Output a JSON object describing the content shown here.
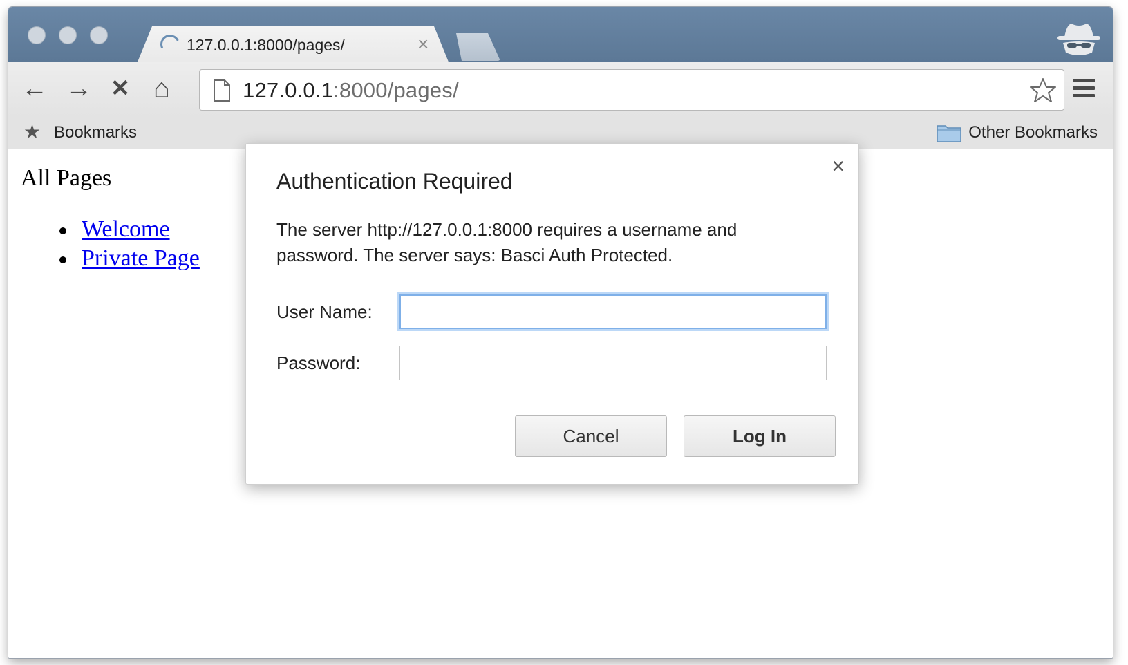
{
  "tab": {
    "title": "127.0.0.1:8000/pages/",
    "close_glyph": "×"
  },
  "toolbar": {
    "back_glyph": "←",
    "forward_glyph": "→",
    "stop_glyph": "✕",
    "home_glyph": "⌂",
    "url_host": "127.0.0.1",
    "url_rest": ":8000/pages/"
  },
  "bookmarks": {
    "label": "Bookmarks",
    "star_glyph": "★",
    "other_label": "Other Bookmarks"
  },
  "page": {
    "heading": "All Pages",
    "links": [
      "Welcome",
      "Private Page"
    ]
  },
  "dialog": {
    "title": "Authentication Required",
    "message": "The server http://127.0.0.1:8000 requires a username and password. The server says: Basci Auth Protected.",
    "username_label": "User Name:",
    "username_value": "",
    "password_label": "Password:",
    "password_value": "",
    "cancel_label": "Cancel",
    "login_label": "Log In",
    "close_glyph": "×"
  },
  "icons": {
    "traffic_lights": [
      "close-dot-icon",
      "minimize-dot-icon",
      "maximize-dot-icon"
    ],
    "incognito": "incognito-icon",
    "page": "page-document-icon",
    "star": "bookmark-star-icon",
    "menu": "hamburger-menu-icon",
    "folder": "folder-icon"
  },
  "colors": {
    "titlebar": "#5c7896",
    "focus_ring": "#7fb0e8",
    "link": "#0000ee"
  }
}
